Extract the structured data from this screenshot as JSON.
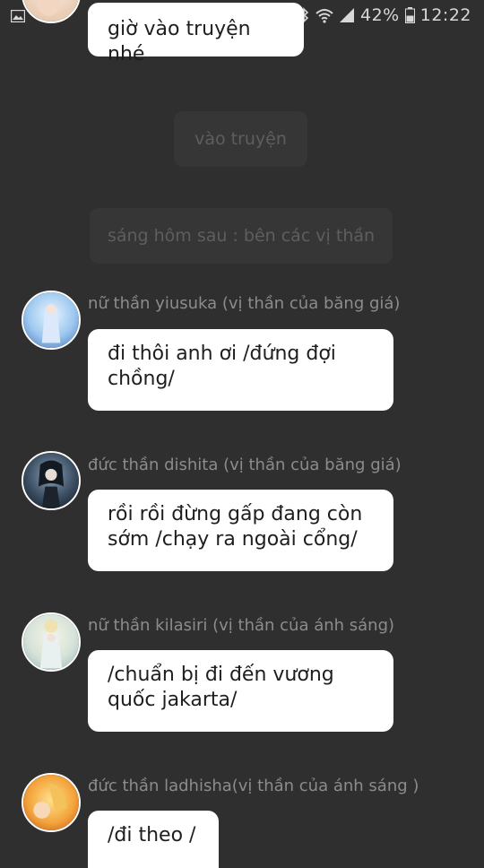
{
  "status_bar": {
    "battery_percent": "42%",
    "time": "12:22",
    "icons": [
      "gallery-icon",
      "bluetooth-icon",
      "wifi-icon",
      "signal-icon",
      "battery-icon"
    ]
  },
  "messages": {
    "m0": {
      "text": "giờ vào truyện nhé"
    },
    "narr1": {
      "text": "vào truyện"
    },
    "narr2": {
      "text": "sáng hôm sau : bên các vị thần"
    },
    "m1": {
      "name": "nữ thần yiusuka (vị thần của băng giá)",
      "text": "đi thôi anh ơi /đứng đợi chồng/"
    },
    "m2": {
      "name": "đức thần dishita (vị thần của băng giá)",
      "text": "rồi rồi  đừng gấp đang còn sớm /chạy ra ngoài cổng/"
    },
    "m3": {
      "name": "nữ thần kilasiri  (vị thần của ánh sáng)",
      "text": "/chuẩn bị đi đến vương quốc jakarta/"
    },
    "m4": {
      "name": "đức thần ladhisha(vị thần của ánh sáng )",
      "text": "/đi theo /"
    }
  },
  "colors": {
    "background": "#2f2f2f",
    "bubble": "#ffffff",
    "name_text": "#8c8c8c",
    "narration_bg": "#363636"
  }
}
